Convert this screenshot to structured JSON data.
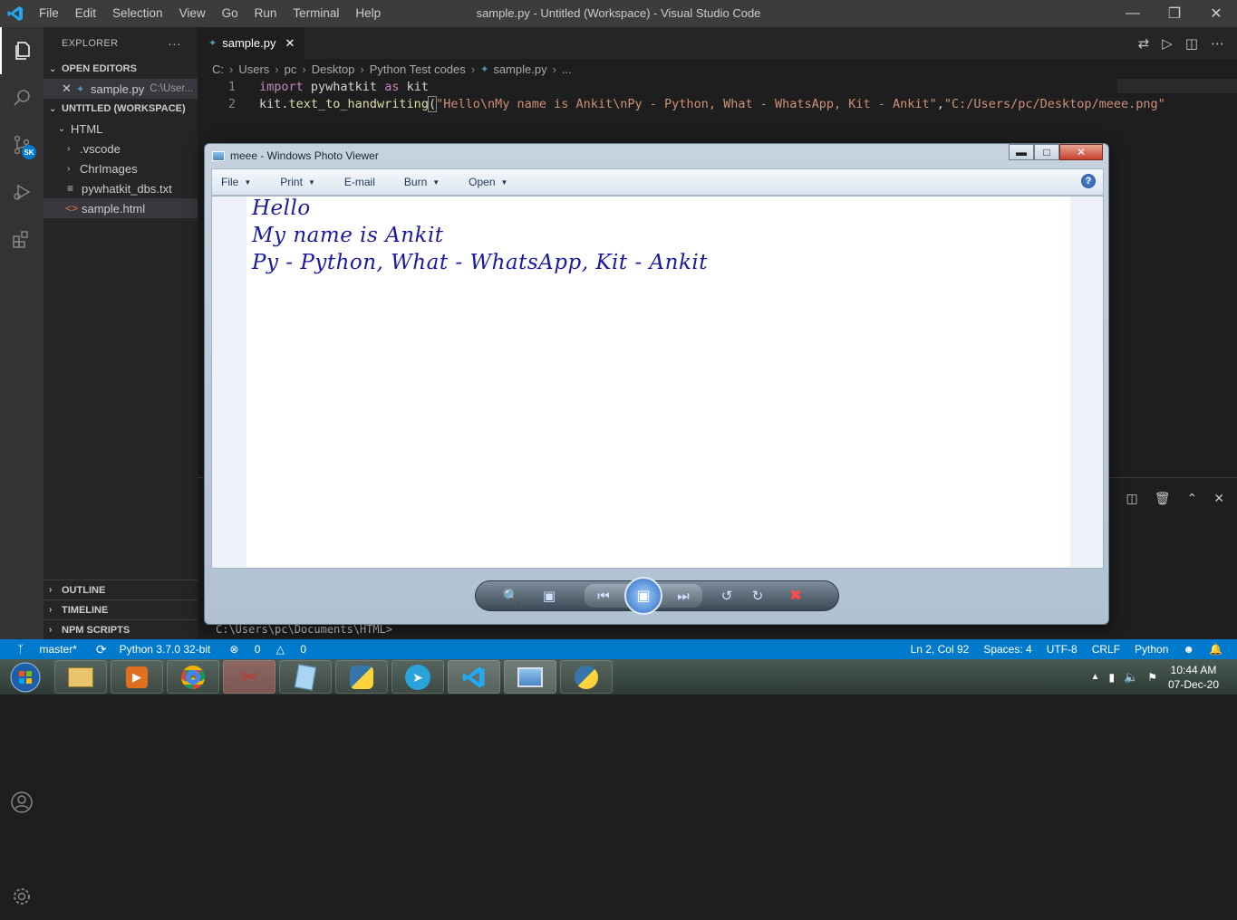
{
  "titlebar": {
    "menus": [
      "File",
      "Edit",
      "Selection",
      "View",
      "Go",
      "Run",
      "Terminal",
      "Help"
    ],
    "title": "sample.py - Untitled (Workspace) - Visual Studio Code"
  },
  "activity": {
    "badge": "SK"
  },
  "sidebar": {
    "header": "EXPLORER",
    "more": "···",
    "open_editors_label": "OPEN EDITORS",
    "open_editor": {
      "name": "sample.py",
      "path": "C:\\User..."
    },
    "workspace_label": "UNTITLED (WORKSPACE)",
    "tree": {
      "folder": "HTML",
      "items": [
        ".vscode",
        "ChrImages",
        "pywhatkit_dbs.txt",
        "sample.html"
      ]
    },
    "outline": "OUTLINE",
    "timeline": "TIMELINE",
    "npm_scripts": "NPM SCRIPTS"
  },
  "editor": {
    "tab_label": "sample.py",
    "breadcrumb": [
      "C:",
      "Users",
      "pc",
      "Desktop",
      "Python Test codes",
      "sample.py",
      "..."
    ],
    "lines": [
      {
        "num": "1",
        "kw1": "import",
        "t1": " pywhatkit ",
        "kw2": "as",
        "t2": " kit"
      },
      {
        "num": "2",
        "pre": "kit.",
        "fn": "text_to_handwriting",
        "paren": "(",
        "s1": "\"Hello\\nMy name is Ankit\\nPy - Python, What - WhatsApp, Kit - Ankit\"",
        "comma": ",",
        "s2": "\"C:/Users/pc/Desktop/meee.png\""
      }
    ]
  },
  "terminal": {
    "prompt": "C:\\Users\\pc\\Documents\\HTML>"
  },
  "statusbar": {
    "branch": "master*",
    "python": "Python 3.7.0 32-bit",
    "errors": "0",
    "warnings": "0",
    "position": "Ln 2, Col 92",
    "spaces": "Spaces: 4",
    "encoding": "UTF-8",
    "eol": "CRLF",
    "language": "Python"
  },
  "photoviewer": {
    "title": "meee - Windows Photo Viewer",
    "menu": [
      "File",
      "Print",
      "E-mail",
      "Burn",
      "Open"
    ],
    "handwriting": [
      "Hello",
      "My name is Ankit",
      "Py - Python, What - WhatsApp, Kit - Ankit"
    ]
  },
  "taskbar": {
    "time": "10:44 AM",
    "date": "07-Dec-20"
  }
}
